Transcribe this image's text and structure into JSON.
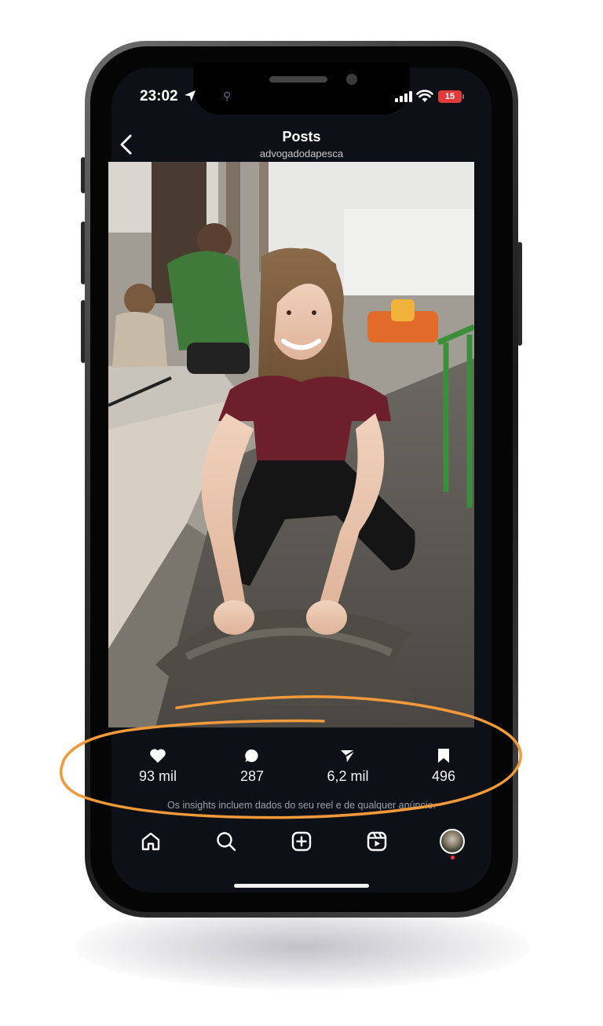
{
  "status_bar": {
    "time": "23:02",
    "extra": "⚲",
    "battery": "15"
  },
  "header": {
    "title": "Posts",
    "username": "advogadodapesca"
  },
  "stats": {
    "likes": "93 mil",
    "comments": "287",
    "shares": "6,2 mil",
    "saves": "496"
  },
  "insights_note": "Os insights incluem dados do seu reel e de qualquer anúncio.",
  "colors": {
    "screen_bg": "#0d1117",
    "annotation": "#f29a3a",
    "notification_dot": "#ff3040"
  },
  "nav": [
    "home-icon",
    "search-icon",
    "create-icon",
    "reels-icon",
    "profile-avatar"
  ]
}
